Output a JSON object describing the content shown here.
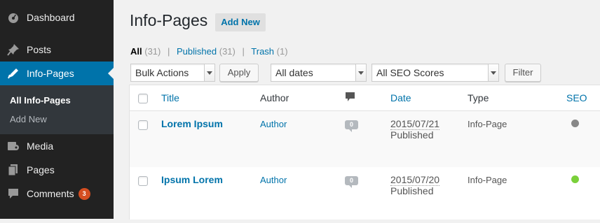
{
  "sidebar": {
    "items": [
      {
        "label": "Dashboard",
        "icon": "dashboard-icon"
      },
      {
        "label": "Posts",
        "icon": "pin-icon"
      },
      {
        "label": "Info-Pages",
        "icon": "pen-icon",
        "active": true
      },
      {
        "label": "Media",
        "icon": "media-icon"
      },
      {
        "label": "Pages",
        "icon": "pages-icon"
      },
      {
        "label": "Comments",
        "icon": "comment-icon",
        "badge": "3"
      }
    ],
    "submenu": [
      {
        "label": "All Info-Pages",
        "current": true
      },
      {
        "label": "Add New"
      }
    ]
  },
  "header": {
    "title": "Info-Pages",
    "add_new_label": "Add New"
  },
  "filters_links": {
    "all_label": "All",
    "all_count": "(31)",
    "published_label": "Published",
    "published_count": "(31)",
    "trash_label": "Trash",
    "trash_count": "(1)",
    "separator": "|"
  },
  "toolbar": {
    "bulk_actions": "Bulk Actions",
    "apply_label": "Apply",
    "dates": "All dates",
    "seo_scores": "All SEO Scores",
    "filter_label": "Filter"
  },
  "table": {
    "columns": {
      "title": "Title",
      "author": "Author",
      "comments_icon": "comment-icon",
      "date": "Date",
      "type": "Type",
      "seo": "SEO"
    },
    "rows": [
      {
        "title": "Lorem Ipsum",
        "author": "Author",
        "comments": "0",
        "date": "2015/07/21",
        "status": "Published",
        "type": "Info-Page",
        "seo_color": "#888888"
      },
      {
        "title": "Ipsum Lorem",
        "author": "Author",
        "comments": "0",
        "date": "2015/07/20",
        "status": "Published",
        "type": "Info-Page",
        "seo_color": "#7ad03a"
      }
    ]
  },
  "colors": {
    "accent": "#0073aa",
    "sidebar_bg": "#222222",
    "badge": "#d54e21"
  }
}
